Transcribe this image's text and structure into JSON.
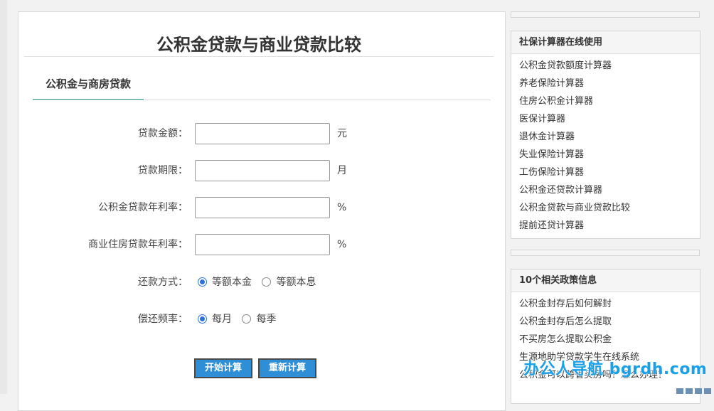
{
  "main": {
    "title": "公积金贷款与商业贷款比较",
    "tab": "公积金与商房贷款",
    "fields": [
      {
        "label": "贷款金额：",
        "value": "",
        "unit": "元"
      },
      {
        "label": "贷款期限：",
        "value": "",
        "unit": "月"
      },
      {
        "label": "公积金贷款年利率：",
        "value": "",
        "unit": "%"
      },
      {
        "label": "商业住房贷款年利率：",
        "value": "",
        "unit": "%"
      }
    ],
    "repayment_method": {
      "label": "还款方式：",
      "options": [
        {
          "label": "等额本金",
          "checked": true
        },
        {
          "label": "等额本息",
          "checked": false
        }
      ]
    },
    "repayment_frequency": {
      "label": "偿还频率：",
      "options": [
        {
          "label": "每月",
          "checked": true
        },
        {
          "label": "每季",
          "checked": false
        }
      ]
    },
    "buttons": {
      "calculate": "开始计算",
      "reset": "重新计算"
    }
  },
  "sidebar": {
    "calculators": {
      "title": "社保计算器在线使用",
      "items": [
        "公积金贷款额度计算器",
        "养老保险计算器",
        "住房公积金计算器",
        "医保计算器",
        "退休金计算器",
        "失业保险计算器",
        "工伤保险计算器",
        "公积金还贷款计算器",
        "公积金贷款与商业贷款比较",
        "提前还贷计算器"
      ]
    },
    "policies": {
      "title": "10个相关政策信息",
      "items": [
        "公积金封存后如何解封",
        "公积金封存后怎么提取",
        "不买房怎么提取公积金",
        "生源地助学贷款学生在线系统",
        "公积金可以跨省买房吗？怎么办理？"
      ]
    }
  },
  "watermark": "办公人导航 bgrdh.com",
  "colors": {
    "accent_tab": "#2aa58b",
    "button": "#2e8fd6",
    "radio": "#2a72d8",
    "watermark": "#1aa0e8"
  }
}
